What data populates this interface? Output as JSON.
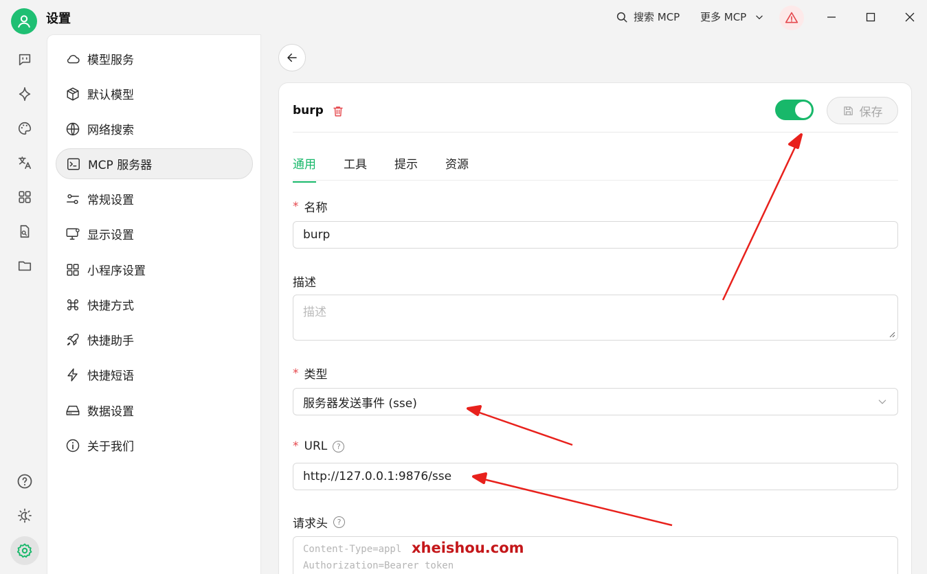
{
  "titlebar": {
    "title": "设置",
    "search_mcp": "搜索 MCP",
    "more_mcp": "更多 MCP"
  },
  "rail": {
    "icons": [
      "chat-icon",
      "sparkle-icon",
      "palette-icon",
      "translate-icon",
      "apps-icon",
      "document-search-icon",
      "folder-icon",
      "help-icon",
      "theme-icon",
      "settings-icon"
    ]
  },
  "menu": {
    "items": [
      {
        "label": "模型服务",
        "icon": "cloud-icon"
      },
      {
        "label": "默认模型",
        "icon": "cube-icon"
      },
      {
        "label": "网络搜索",
        "icon": "globe-icon"
      },
      {
        "label": "MCP 服务器",
        "icon": "terminal-icon",
        "active": true
      },
      {
        "label": "常规设置",
        "icon": "sliders-icon"
      },
      {
        "label": "显示设置",
        "icon": "monitor-icon"
      },
      {
        "label": "小程序设置",
        "icon": "apps-icon"
      },
      {
        "label": "快捷方式",
        "icon": "command-icon"
      },
      {
        "label": "快捷助手",
        "icon": "rocket-icon"
      },
      {
        "label": "快捷短语",
        "icon": "zap-icon"
      },
      {
        "label": "数据设置",
        "icon": "drive-icon"
      },
      {
        "label": "关于我们",
        "icon": "info-icon"
      }
    ]
  },
  "server": {
    "name": "burp",
    "enabled": true,
    "save_label": "保存"
  },
  "tabs": [
    "通用",
    "工具",
    "提示",
    "资源"
  ],
  "form": {
    "name_label": "名称",
    "name_value": "burp",
    "desc_label": "描述",
    "desc_placeholder": "描述",
    "type_label": "类型",
    "type_value": "服务器发送事件 (sse)",
    "url_label": "URL",
    "url_value": "http://127.0.0.1:9876/sse",
    "headers_label": "请求头",
    "headers_placeholder_line1": "Content-Type=appl",
    "headers_placeholder_line2": "Authorization=Bearer token",
    "required_mark": "*",
    "help_mark": "?"
  },
  "watermark": "xheishou.com",
  "colors": {
    "accent": "#18b86a",
    "danger": "#e5484d",
    "annotation": "#e8211c"
  }
}
